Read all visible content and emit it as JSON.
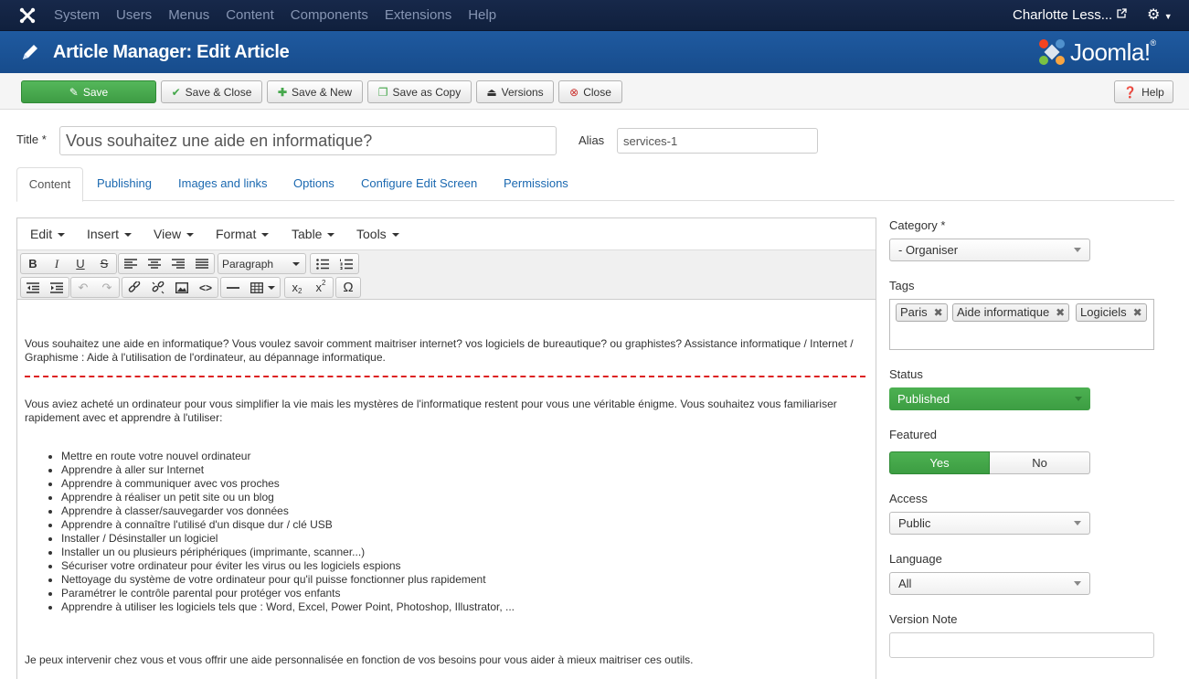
{
  "navbar": {
    "menu": [
      "System",
      "Users",
      "Menus",
      "Content",
      "Components",
      "Extensions",
      "Help"
    ],
    "user": "Charlotte Less..."
  },
  "header": {
    "title": "Article Manager: Edit Article",
    "brand": "Joomla!"
  },
  "toolbar": {
    "save": "Save",
    "save_close": "Save & Close",
    "save_new": "Save & New",
    "save_copy": "Save as Copy",
    "versions": "Versions",
    "close": "Close",
    "help": "Help"
  },
  "form": {
    "title_label": "Title *",
    "title_value": "Vous souhaitez une aide en informatique?",
    "alias_label": "Alias",
    "alias_value": "services-1"
  },
  "tabs": [
    "Content",
    "Publishing",
    "Images and links",
    "Options",
    "Configure Edit Screen",
    "Permissions"
  ],
  "editor": {
    "menus": [
      "Edit",
      "Insert",
      "View",
      "Format",
      "Table",
      "Tools"
    ],
    "format_select": "Paragraph",
    "para1": "Vous souhaitez une aide en informatique? Vous voulez savoir comment maitriser internet? vos logiciels de bureautique? ou graphistes? Assistance informatique / Internet / Graphisme : Aide à l'utilisation de l'ordinateur, au dépannage informatique.",
    "para2": "Vous aviez acheté un ordinateur pour vous simplifier la vie mais les mystères de l'informatique restent pour vous une véritable énigme. Vous souhaitez vous familiariser rapidement avec et apprendre à l'utiliser:",
    "list": [
      "Mettre en route votre nouvel ordinateur",
      "Apprendre à aller sur Internet",
      "Apprendre à communiquer avec vos proches",
      "Apprendre à réaliser un petit site ou un blog",
      "Apprendre à classer/sauvegarder vos données",
      "Apprendre à connaître l'utilisé d'un disque dur / clé USB",
      "Installer / Désinstaller un logiciel",
      "Installer un ou plusieurs périphériques (imprimante, scanner...)",
      "Sécuriser votre ordinateur pour éviter les virus ou les logiciels espions",
      "Nettoyage du système de votre ordinateur pour qu'il puisse fonctionner plus rapidement",
      "Paramétrer le contrôle parental pour protéger vos enfants",
      "Apprendre à utiliser les logiciels tels que : Word, Excel, Power Point, Photoshop, Illustrator, ..."
    ],
    "para3": "Je peux intervenir chez vous et vous offrir une aide personnalisée en fonction de vos besoins pour vous aider à mieux maitriser ces outils."
  },
  "sidebar": {
    "category_label": "Category *",
    "category_value": "- Organiser",
    "tags_label": "Tags",
    "tags": [
      "Paris",
      "Aide informatique",
      "Logiciels"
    ],
    "status_label": "Status",
    "status_value": "Published",
    "featured_label": "Featured",
    "featured_yes": "Yes",
    "featured_no": "No",
    "access_label": "Access",
    "access_value": "Public",
    "language_label": "Language",
    "language_value": "All",
    "version_note_label": "Version Note"
  },
  "colors": {
    "navbar": "#10203d",
    "header": "#1f5aa0",
    "save_green": "#46a84c",
    "link_blue": "#1a68b0",
    "dashed_red": "#dd2222"
  }
}
